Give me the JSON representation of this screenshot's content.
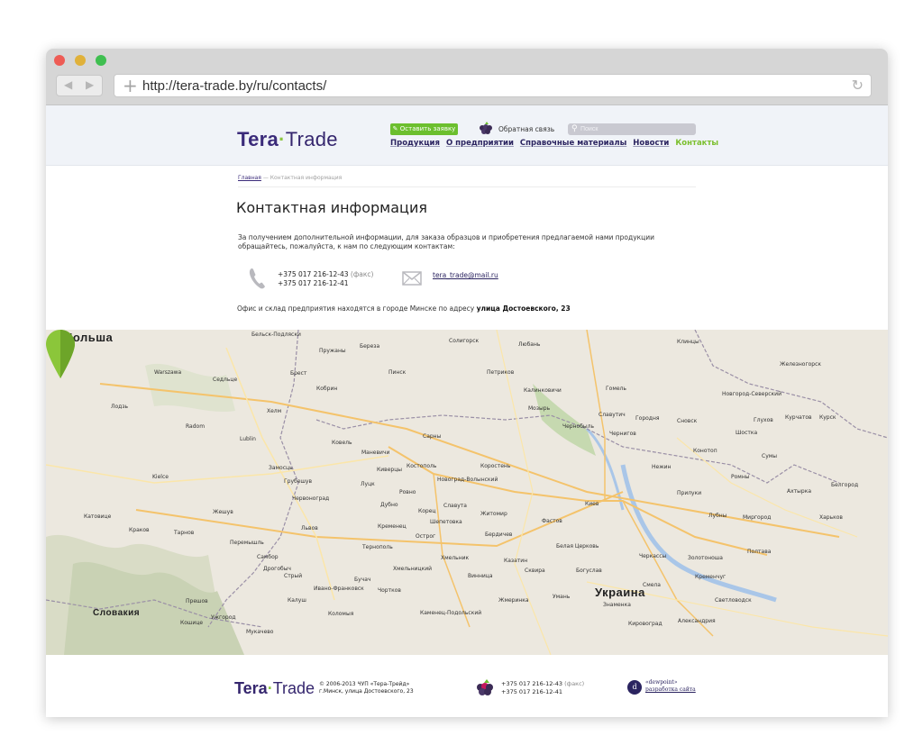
{
  "browser": {
    "url": "http://tera-trade.by/ru/contacts/",
    "back_glyph": "◀",
    "forward_glyph": "▶",
    "reload_glyph": "↻",
    "new_tab_glyph": "+"
  },
  "header": {
    "logo_part1": "Tera",
    "logo_dot": "·",
    "logo_part2": "Trade",
    "request_button": "✎ Оставить заявку",
    "feedback_label": "Обратная связь",
    "search_placeholder": "Поиск",
    "search_icon": "⚲",
    "nav": [
      {
        "label": "Продукция"
      },
      {
        "label": "О предприятии"
      },
      {
        "label": "Справочные материалы"
      },
      {
        "label": "Новости"
      },
      {
        "label": "Контакты"
      }
    ]
  },
  "breadcrumb": {
    "home": "Главная",
    "separator": " — ",
    "current": "Контактная информация"
  },
  "content": {
    "title": "Контактная информация",
    "intro": "За получением дополнительной информации, для заказа образцов и приобретения предлагаемой нами продукции обращайтесь, пожалуйста, к нам по следующим контактам:",
    "phone1": "+375 017 216-12-43",
    "phone1_note": "(факс)",
    "phone2": "+375 017 216-12-41",
    "email": "tera_trade@mail.ru",
    "office_text": "Офис и склад предприятия находятся в городе Минске по адресу",
    "office_address": "улица Достоевского, 23"
  },
  "map": {
    "countries": {
      "poland": "Польша",
      "ukraine": "Украина",
      "slovakia": "Словакия"
    },
    "cities": {
      "belsk": "Бельск-Подляски",
      "pruzhany": "Пружаны",
      "bereza": "Береза",
      "pinsk": "Пинск",
      "soligorsk": "Солигорск",
      "lyuban": "Любань",
      "petrikov": "Петриков",
      "kalinkovichi": "Калинковичи",
      "mozyr": "Мозырь",
      "gomel": "Гомель",
      "klintsy": "Клинцы",
      "novgorod_s": "Новгород-Северский",
      "zheleznogorsk": "Железногорск",
      "kursk": "Курск",
      "kurchatov": "Курчатов",
      "brest": "Брест",
      "kobrin": "Кобрин",
      "kovel": "Ковель",
      "kiverci": "Киверцы",
      "lutsk": "Луцк",
      "rovno": "Ровно",
      "korosten": "Коростень",
      "zhitomir": "Житомир",
      "kiev": "Киев",
      "chernigov": "Чернигов",
      "nezhin": "Нежин",
      "sumy": "Сумы",
      "belgorod": "Белгород",
      "kharkov": "Харьков",
      "poltava": "Полтава",
      "kremenchug": "Кременчуг",
      "cherkassy": "Черкассы",
      "kirovograd": "Кировоград",
      "belaya": "Белая Церковь",
      "vinnica": "Винница",
      "khmelnitsky": "Хмельницкий",
      "ternopol": "Тернополь",
      "lvov": "Львов",
      "ivano": "Ивано-Франковск",
      "chervonograd": "Червоноград",
      "lublin": "Lublin",
      "warszawa": "Warszawa",
      "radom": "Radom",
      "kielce": "Kielce",
      "krakow": "Краков",
      "katowice": "Катовице",
      "tarnow": "Тарнов",
      "zheshuv": "Жешув",
      "uzhgorod": "Ужгород",
      "mukachevo": "Мукачево",
      "koshice": "Кошице",
      "prjashev": "Прешов",
      "zamosc": "Замосць",
      "hrubieszow": "Грубешув",
      "chelm": "Хелм",
      "siedlce": "Седльце",
      "lodz": "Лодзь",
      "kamenec": "Каменец-Подольский",
      "shepetovka": "Шепетовка",
      "berdichev": "Бердичев",
      "fastov": "Фастов",
      "novograd": "Новоград-Волынский",
      "uman": "Умань",
      "aleksandriya": "Александрия",
      "konotop": "Конотоп",
      "romny": "Ромны",
      "priluki": "Прилуки",
      "lubny": "Лубны",
      "mirgorod": "Миргород",
      "akhtyrka": "Ахтырка",
      "dubno": "Дубно",
      "kremenec": "Кременец",
      "manevichi": "Маневичи",
      "sarny": "Сарны",
      "kostopol": "Костополь",
      "korec": "Корец",
      "chernobyl": "Чернобыль",
      "slavutich": "Славутич",
      "gorodnya": "Городня",
      "snovsk": "Сновск",
      "shostka": "Шостка",
      "glukhov": "Глухов",
      "ostrog": "Острог",
      "slavuta": "Славута",
      "kolomyya": "Коломыя",
      "drogobych": "Дрогобыч",
      "stryj": "Стрый",
      "sambor": "Самбор",
      "przemysl": "Перемышль",
      "kalush": "Калуш",
      "chortkov": "Чортков",
      "buchach": "Бучач",
      "zhmerinka": "Жмеринка",
      "khmelnik": "Хмельник",
      "kazatin": "Казатин",
      "skvira": "Сквира",
      "boguslav": "Богуслав",
      "smela": "Смела",
      "zolotonosha": "Золотоноша",
      "svetlovodsk": "Светловодск",
      "znamenka": "Знаменка"
    }
  }
}
